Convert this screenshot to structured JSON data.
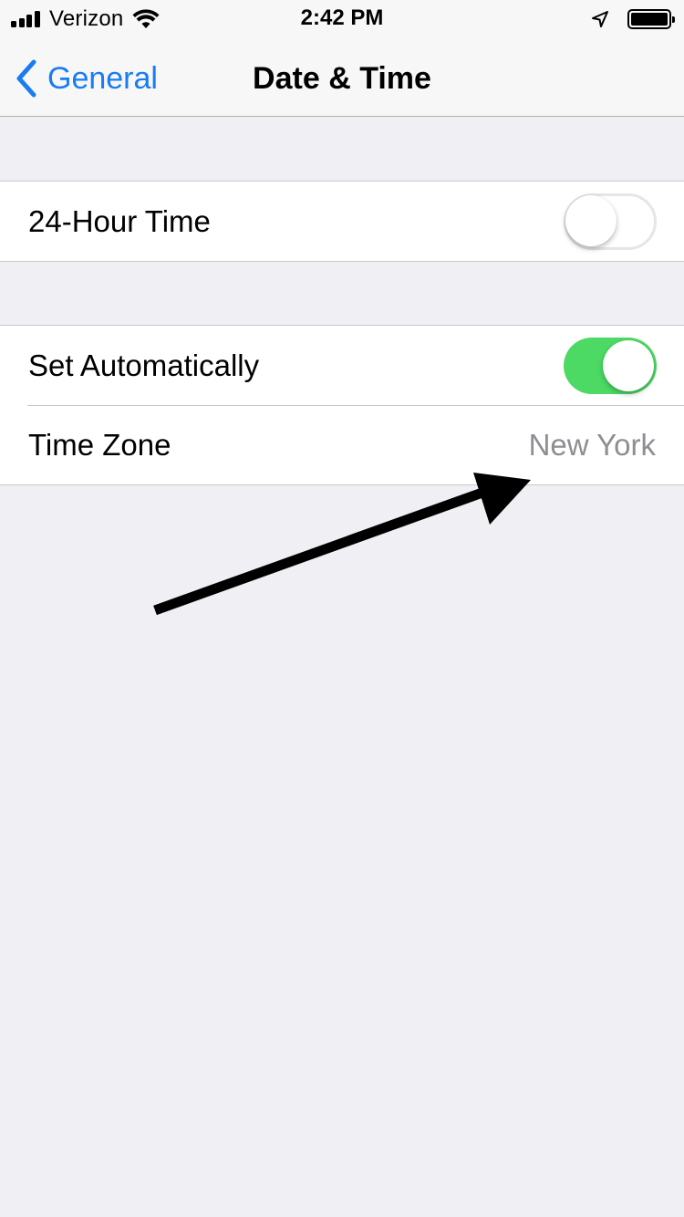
{
  "status_bar": {
    "carrier": "Verizon",
    "time": "2:42 PM",
    "icons": [
      "signal-bars-icon",
      "wifi-icon",
      "location-arrow-icon",
      "battery-icon"
    ]
  },
  "nav": {
    "back_label": "General",
    "title": "Date & Time"
  },
  "groups": {
    "first": {
      "rows": [
        {
          "label": "24-Hour Time",
          "toggle": false
        }
      ]
    },
    "second": {
      "rows": [
        {
          "label": "Set Automatically",
          "toggle": true
        },
        {
          "label": "Time Zone",
          "value": "New York"
        }
      ]
    }
  },
  "colors": {
    "accent": "#1a7cf2",
    "toggle_on": "#4cd964",
    "background": "#efeff4",
    "secondary_text": "#8e8e93"
  },
  "annotation": {
    "icon": "arrow-annotation-icon",
    "color": "#000000"
  }
}
